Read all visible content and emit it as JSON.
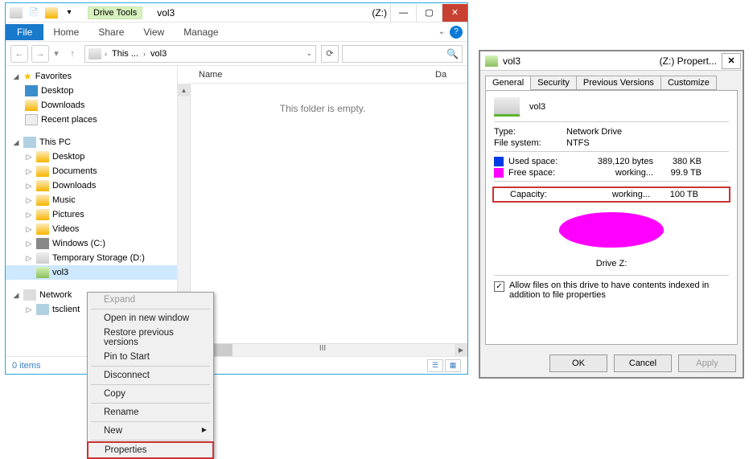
{
  "explorer": {
    "drive_tools_label": "Drive Tools",
    "title": "vol3",
    "drive_letter": "(Z:)",
    "ribbon": {
      "file": "File",
      "home": "Home",
      "share": "Share",
      "view": "View",
      "manage": "Manage"
    },
    "address": {
      "root": "This ...",
      "seg": "vol3"
    },
    "columns": {
      "name": "Name",
      "da": "Da"
    },
    "empty": "This folder is empty.",
    "status_items": "0 items",
    "scroll_marker": "III",
    "tree": {
      "favorites": "Favorites",
      "desktop": "Desktop",
      "downloads": "Downloads",
      "recent": "Recent places",
      "thispc": "This PC",
      "pc_desktop": "Desktop",
      "documents": "Documents",
      "pc_downloads": "Downloads",
      "music": "Music",
      "pictures": "Pictures",
      "videos": "Videos",
      "windows_c": "Windows (C:)",
      "temp_d": "Temporary Storage (D:)",
      "vol3": "vol3",
      "network": "Network",
      "tsclient": "tsclient"
    }
  },
  "context_menu": {
    "expand": "Expand",
    "open_new": "Open in new window",
    "restore": "Restore previous versions",
    "pin": "Pin to Start",
    "disconnect": "Disconnect",
    "copy": "Copy",
    "rename": "Rename",
    "new": "New",
    "properties": "Properties"
  },
  "props": {
    "window_title": "vol3",
    "window_suffix": "(Z:) Propert...",
    "tabs": {
      "general": "General",
      "security": "Security",
      "prev": "Previous Versions",
      "customize": "Customize"
    },
    "vol_name": "vol3",
    "type_label": "Type:",
    "type_value": "Network Drive",
    "fs_label": "File system:",
    "fs_value": "NTFS",
    "used_label": "Used space:",
    "used_bytes": "389,120 bytes",
    "used_h": "380 KB",
    "free_label": "Free space:",
    "free_bytes": "working...",
    "free_h": "99.9 TB",
    "cap_label": "Capacity:",
    "cap_bytes": "working...",
    "cap_h": "100 TB",
    "drive_label": "Drive Z:",
    "index_text": "Allow files on this drive to have contents indexed in addition to file properties",
    "ok": "OK",
    "cancel": "Cancel",
    "apply": "Apply"
  }
}
